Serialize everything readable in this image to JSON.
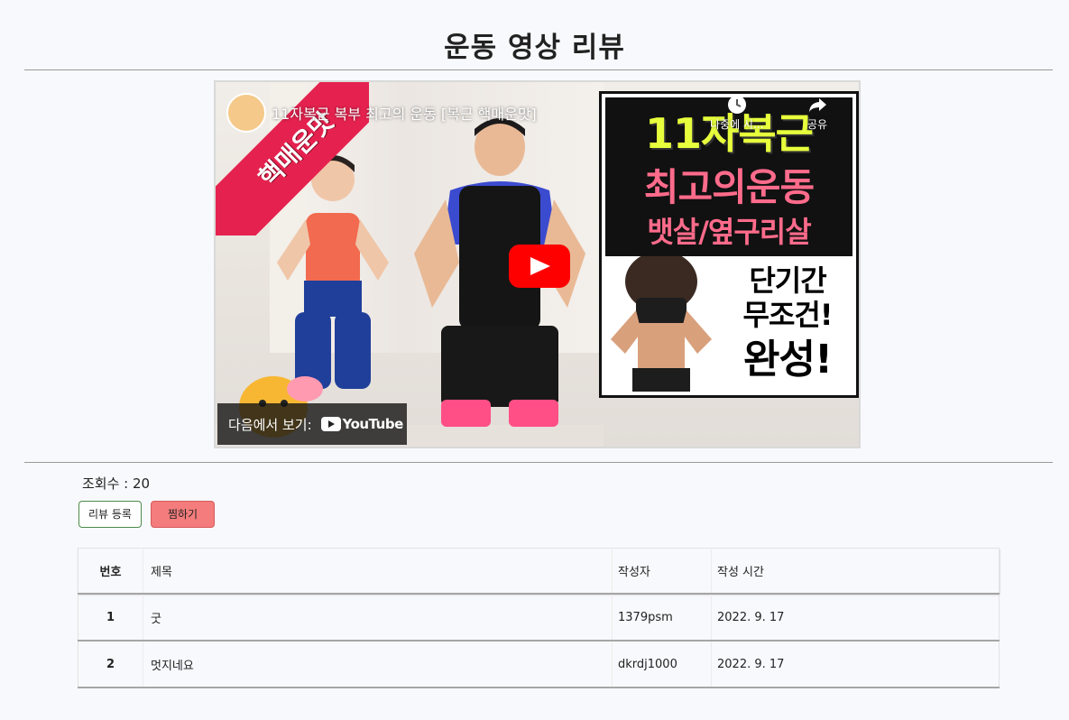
{
  "page": {
    "title": "운동 영상 리뷰"
  },
  "video": {
    "title": "11자복근 복부 최고의 운동 [복근 핵매운맛]",
    "channel_ribbon": "핵매운맛",
    "watch_later_label": "나중에 시...",
    "share_label": "공유",
    "watch_on_label": "다음에서 보기:",
    "youtube_logo_text": "YouTube",
    "thumbnail_text": {
      "line1": "11자복근",
      "line2": "최고의운동",
      "line3": "뱃살/옆구리살",
      "side1": "단기간",
      "side2": "무조건!",
      "side3": "완성!"
    },
    "play_color": "#ff0000",
    "ribbon_color": "#e5224f"
  },
  "stats": {
    "views_label": "조회수 : 20"
  },
  "actions": {
    "review_button": "리뷰 등록",
    "like_button": "찜하기"
  },
  "table": {
    "headers": {
      "no": "번호",
      "title": "제목",
      "author": "작성자",
      "time": "작성 시간"
    },
    "rows": [
      {
        "no": "1",
        "title": "굿",
        "author": "1379psm",
        "time": "2022. 9. 17"
      },
      {
        "no": "2",
        "title": "멋지네요",
        "author": "dkrdj1000",
        "time": "2022. 9. 17"
      }
    ]
  }
}
